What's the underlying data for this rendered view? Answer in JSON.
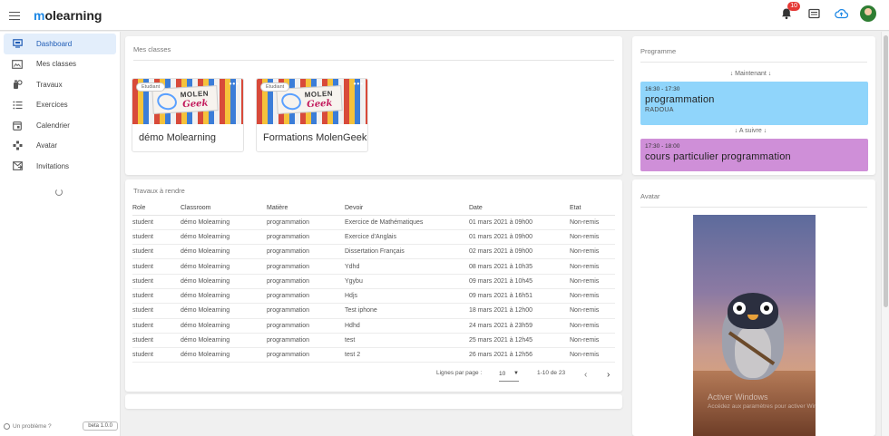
{
  "app": {
    "logo_first": "m",
    "logo_rest": "olearning",
    "notification_count": "10"
  },
  "sidebar": {
    "items": [
      {
        "label": "Dashboard",
        "icon": "monitor-icon",
        "active": true
      },
      {
        "label": "Mes classes",
        "icon": "classes-icon"
      },
      {
        "label": "Travaux",
        "icon": "assignments-icon"
      },
      {
        "label": "Exercices",
        "icon": "list-icon"
      },
      {
        "label": "Calendrier",
        "icon": "calendar-icon"
      },
      {
        "label": "Avatar",
        "icon": "gamepad-icon"
      },
      {
        "label": "Invitations",
        "icon": "invitation-icon"
      }
    ],
    "help_label": "Un problème ?",
    "version": "beta 1.0.0"
  },
  "classes": {
    "title": "Mes classes",
    "items": [
      {
        "name": "démo Molearning",
        "badge": "Etudiant"
      },
      {
        "name": "Formations MolenGeek",
        "badge": "Etudiant"
      }
    ]
  },
  "travaux": {
    "title": "Travaux à rendre",
    "columns": [
      "Role",
      "Classroom",
      "Matière",
      "Devoir",
      "Date",
      "Etat"
    ],
    "rows": [
      [
        "student",
        "démo Molearning",
        "programmation",
        "Exercice de Mathématiques",
        "01 mars 2021 à 09h00",
        "Non-remis"
      ],
      [
        "student",
        "démo Molearning",
        "programmation",
        "Exercice d'Anglais",
        "01 mars 2021 à 09h00",
        "Non-remis"
      ],
      [
        "student",
        "démo Molearning",
        "programmation",
        "Dissertation Français",
        "02 mars 2021 à 09h00",
        "Non-remis"
      ],
      [
        "student",
        "démo Molearning",
        "programmation",
        "Ydhd",
        "08 mars 2021 à 10h35",
        "Non-remis"
      ],
      [
        "student",
        "démo Molearning",
        "programmation",
        "Ygybu",
        "09 mars 2021 à 10h45",
        "Non-remis"
      ],
      [
        "student",
        "démo Molearning",
        "programmation",
        "Hdjs",
        "09 mars 2021 à 16h51",
        "Non-remis"
      ],
      [
        "student",
        "démo Molearning",
        "programmation",
        "Test iphone",
        "18 mars 2021 à 12h00",
        "Non-remis"
      ],
      [
        "student",
        "démo Molearning",
        "programmation",
        "Hdhd",
        "24 mars 2021 à 23h59",
        "Non-remis"
      ],
      [
        "student",
        "démo Molearning",
        "programmation",
        "test",
        "25 mars 2021 à 12h45",
        "Non-remis"
      ],
      [
        "student",
        "démo Molearning",
        "programmation",
        "test 2",
        "26 mars 2021 à 12h56",
        "Non-remis"
      ]
    ],
    "pagination": {
      "rows_per_page_label": "Lignes par page :",
      "rows_per_page": "10",
      "range": "1-10 de 23"
    }
  },
  "programme": {
    "title": "Programme",
    "now_label": "↓ Maintenant ↓",
    "next_label": "↓ A suivre ↓",
    "current": {
      "time": "16:30 - 17:30",
      "title": "programmation",
      "teacher": "RADOUA",
      "color": "#90d5fb"
    },
    "next": {
      "time": "17:30 - 18:00",
      "title": "cours particulier programmation",
      "color": "#cf8fd8"
    }
  },
  "avatar": {
    "title": "Avatar"
  },
  "watermark": {
    "line1": "Activer Windows",
    "line2": "Accédez aux paramètres pour activer Windows."
  }
}
